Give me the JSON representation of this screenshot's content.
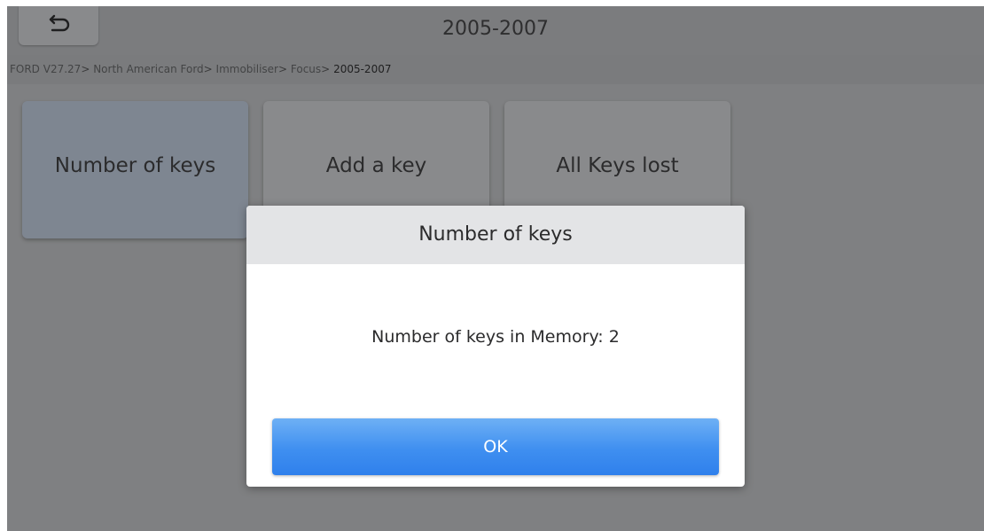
{
  "header": {
    "title": "2005-2007",
    "back_icon": "undo-arrow-icon"
  },
  "breadcrumb": {
    "items": [
      "FORD V27.27",
      "North American Ford",
      "Immobiliser",
      "Focus"
    ],
    "current": "2005-2007",
    "separator": ">"
  },
  "tiles": [
    {
      "label": "Number of keys",
      "selected": true
    },
    {
      "label": "Add a key",
      "selected": false
    },
    {
      "label": "All Keys lost",
      "selected": false
    }
  ],
  "dialog": {
    "title": "Number of keys",
    "message": "Number of keys in Memory: 2",
    "ok_label": "OK"
  },
  "colors": {
    "overlay_background": "#7f8082",
    "dialog_header": "#e3e4e6",
    "ok_button": "#3f8ff0"
  }
}
